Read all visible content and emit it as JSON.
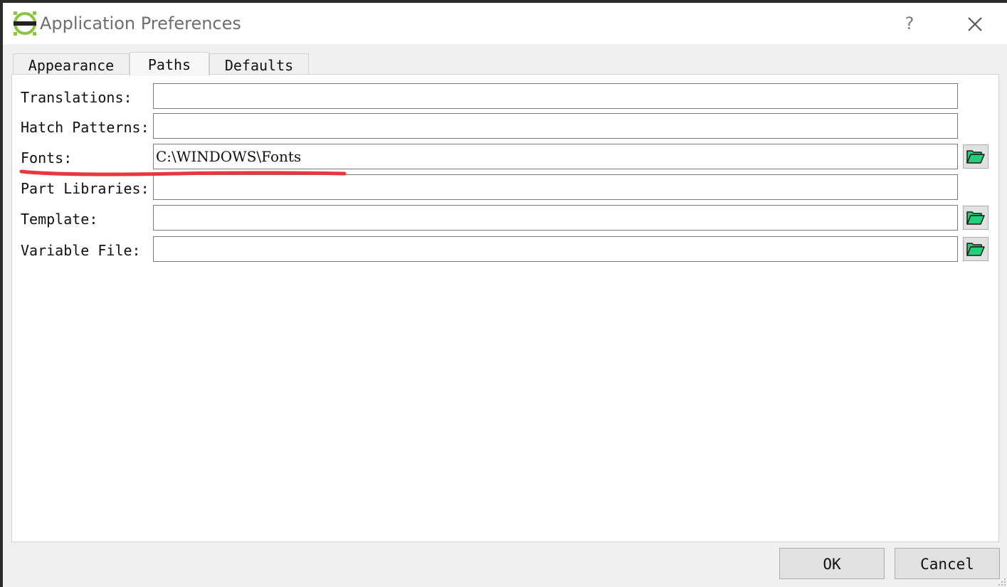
{
  "window": {
    "title": "Application Preferences",
    "help_glyph": "?",
    "icons": {
      "app": "app-logo-icon",
      "close": "close-icon"
    }
  },
  "tabs": [
    {
      "label": "Appearance",
      "active": false
    },
    {
      "label": "Paths",
      "active": true
    },
    {
      "label": "Defaults",
      "active": false
    }
  ],
  "paths": {
    "rows": [
      {
        "label": "Translations:",
        "value": "",
        "has_browse": false
      },
      {
        "label": "Hatch Patterns:",
        "value": "",
        "has_browse": false
      },
      {
        "label": "Fonts:",
        "value": "C:\\WINDOWS\\Fonts",
        "has_browse": true,
        "highlighted": true
      },
      {
        "label": "Part Libraries:",
        "value": "",
        "has_browse": false
      },
      {
        "label": "Template:",
        "value": "",
        "has_browse": true
      },
      {
        "label": "Variable File:",
        "value": "",
        "has_browse": true
      }
    ],
    "browse_icon": "folder-open-icon"
  },
  "footer": {
    "ok_label": "OK",
    "cancel_label": "Cancel"
  },
  "colors": {
    "annotation_red": "#e8383d",
    "logo_green": "#8cc63f",
    "folder_green": "#22d07a"
  }
}
